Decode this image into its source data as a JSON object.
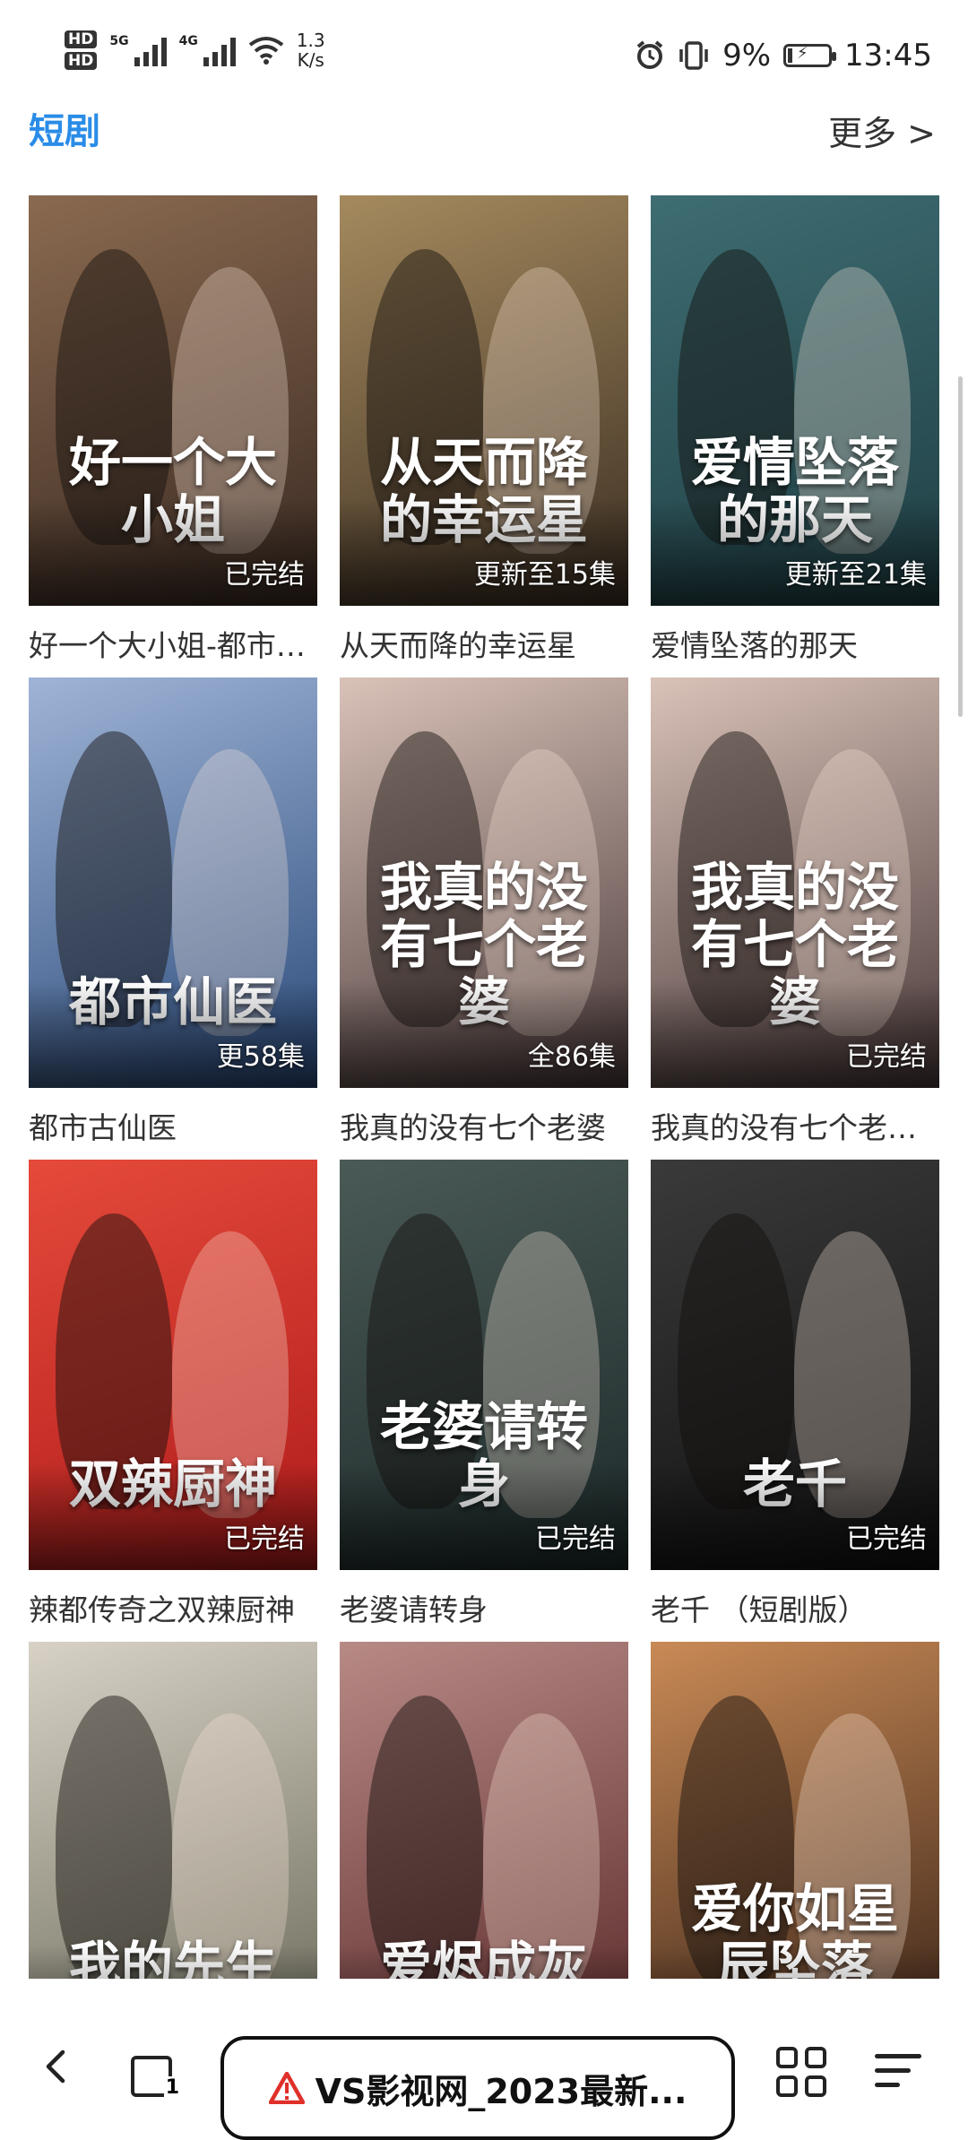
{
  "status_bar": {
    "hd1": "HD",
    "hd2": "HD",
    "net1": "5G",
    "net2": "4G",
    "speed_value": "1.3",
    "speed_unit": "K/s",
    "battery_pct": "9%",
    "time": "13:45"
  },
  "section": {
    "title": "短剧",
    "more_label": "更多 >"
  },
  "items": [
    {
      "title": "好一个大小姐-都市女强人",
      "poster_text": "好一个大小姐",
      "badge": "已完结",
      "colors": [
        "#3a2a22",
        "#8a6a50"
      ]
    },
    {
      "title": "从天而降的幸运星",
      "poster_text": "从天而降的幸运星",
      "badge": "更新至15集",
      "colors": [
        "#3b2e22",
        "#a58a5e"
      ]
    },
    {
      "title": "爱情坠落的那天",
      "poster_text": "爱情坠落的那天",
      "badge": "更新至21集",
      "colors": [
        "#1f3f44",
        "#3e6d72"
      ]
    },
    {
      "title": "都市古仙医",
      "poster_text": "都市仙医",
      "badge": "更58集",
      "colors": [
        "#2a4a7a",
        "#9fb4d6"
      ]
    },
    {
      "title": "我真的没有七个老婆",
      "poster_text": "我真的没有七个老婆",
      "badge": "全86集",
      "colors": [
        "#4a3a3a",
        "#d9c2b8"
      ]
    },
    {
      "title": "我真的没有七个老婆（短剧版）",
      "poster_text": "我真的没有七个老婆",
      "badge": "已完结",
      "colors": [
        "#4a3a3a",
        "#d9c2b8"
      ]
    },
    {
      "title": "辣都传奇之双辣厨神",
      "poster_text": "双辣厨神",
      "badge": "已完结",
      "colors": [
        "#b01b1b",
        "#e54a3a"
      ]
    },
    {
      "title": "老婆请转身",
      "poster_text": "老婆请转身",
      "badge": "已完结",
      "colors": [
        "#1d2a2a",
        "#4a5a56"
      ]
    },
    {
      "title": "老千 （短剧版）",
      "poster_text": "老千",
      "badge": "已完结",
      "colors": [
        "#111111",
        "#3a3a3a"
      ]
    },
    {
      "title": "",
      "poster_text": "我的先生",
      "badge": "",
      "colors": [
        "#6a6a5a",
        "#d8d2c6"
      ]
    },
    {
      "title": "",
      "poster_text": "爱烬成灰",
      "badge": "",
      "colors": [
        "#5a2a2a",
        "#b88a86"
      ]
    },
    {
      "title": "",
      "poster_text": "爱你如星辰坠落",
      "badge": "",
      "colors": [
        "#3a2418",
        "#c98a56"
      ]
    }
  ],
  "bottom_nav": {
    "url_text": "VS影视网_2023最新...",
    "tabs_count": "1"
  },
  "colors": {
    "accent": "#2a8ce8",
    "warning": "#e0302a"
  }
}
